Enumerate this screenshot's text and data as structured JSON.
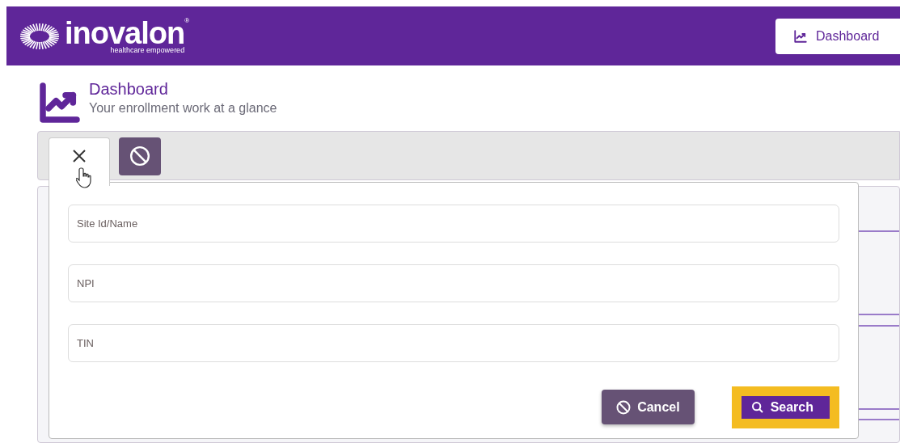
{
  "header": {
    "logo": {
      "wordmark": "inovalon",
      "registered": "®",
      "tagline": "healthcare empowered"
    },
    "nav_button": {
      "label": "Dashboard"
    }
  },
  "page": {
    "title": "Dashboard",
    "subtitle": "Your enrollment work at a glance"
  },
  "toolbar": {
    "tabs": [
      {
        "kind": "close",
        "selected": true
      },
      {
        "kind": "block",
        "selected": false
      }
    ]
  },
  "search_panel": {
    "fields": [
      {
        "placeholder": "Site Id/Name"
      },
      {
        "placeholder": "NPI"
      },
      {
        "placeholder": "TIN"
      }
    ],
    "buttons": [
      {
        "kind": "cancel",
        "label": "Cancel",
        "focused": false
      },
      {
        "kind": "search",
        "label": "Search",
        "focused": true
      }
    ]
  }
}
